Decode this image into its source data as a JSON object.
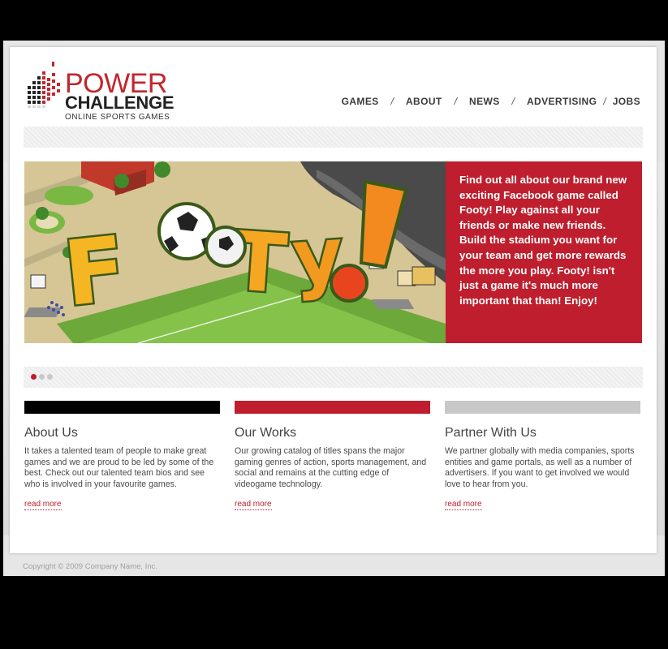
{
  "logo": {
    "word_top": "POWER",
    "word_mid": "CHALLENGE",
    "tagline": "ONLINE SPORTS GAMES"
  },
  "nav": {
    "items": [
      {
        "label": "GAMES"
      },
      {
        "label": "ABOUT"
      },
      {
        "label": "NEWS"
      },
      {
        "label": "ADVERTISING"
      },
      {
        "label": "JOBS"
      }
    ],
    "separator": "/"
  },
  "hero": {
    "game_logo_text": "FooTy!",
    "text": "Find out all about our brand new exciting Facebook game called Footy! Play against all your friends or make new friends. Build the stadium you want for your team and get more rewards the more you play. Footy! isn't just a game it's much more important that than! Enjoy!"
  },
  "slider": {
    "dots": 3,
    "active_index": 0
  },
  "columns": [
    {
      "title": "About Us",
      "text": "It takes a talented team of people to make great games and we are proud to be led by some of the best. Check out our talented team bios and see who is involved in your favourite games.",
      "link": "read more",
      "strip_color": "#000000"
    },
    {
      "title": "Our Works",
      "text": "Our growing catalog of titles spans the major gaming genres of action, sports management, and social and remains at the cutting edge of videogame technology.",
      "link": "read more",
      "strip_color": "#be1e2d"
    },
    {
      "title": "Partner With Us",
      "text": "We partner globally with media companies, sports entities and game portals, as well as a number of advertisers. If you want to get involved we would love to hear from you.",
      "link": "read more",
      "strip_color": "#c8c8c8"
    }
  ],
  "footer": {
    "copyright": "Copyright © 2009 Company Name, Inc."
  },
  "colors": {
    "brand_red": "#be1e2d",
    "text_dark": "#3a3a3a"
  }
}
